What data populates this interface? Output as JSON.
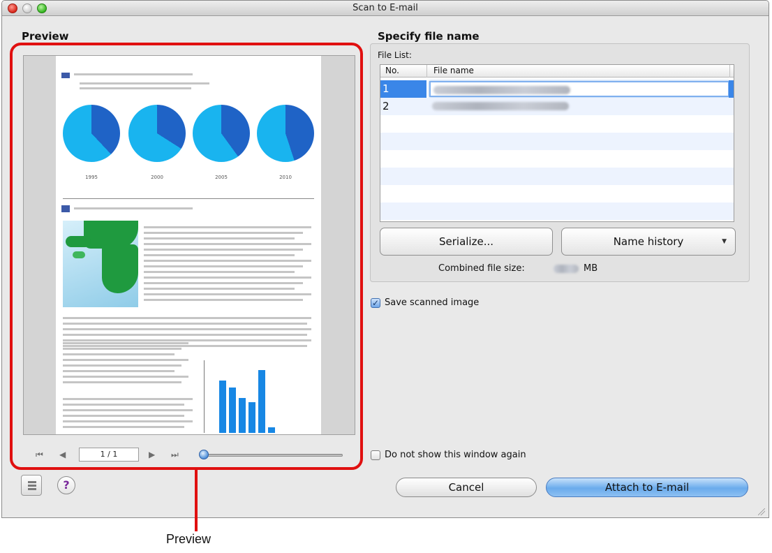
{
  "window": {
    "title": "Scan to E-mail"
  },
  "preview": {
    "section_title": "Preview",
    "page_indicator": "1 / 1",
    "document": {
      "pie_years": [
        "1995",
        "2000",
        "2005",
        "2010"
      ],
      "bar_values": [
        75,
        65,
        50,
        44,
        90,
        8
      ]
    }
  },
  "file_name": {
    "section_title": "Specify file name",
    "file_list_label": "File List:",
    "columns": [
      "No.",
      "File name"
    ],
    "rows": [
      {
        "no": "1",
        "selected": true
      },
      {
        "no": "2",
        "selected": false
      }
    ],
    "serialize_label": "Serialize...",
    "name_history_label": "Name history",
    "combined_size_label": "Combined file size:",
    "combined_size_unit": "MB"
  },
  "options": {
    "save_scanned_image": {
      "label": "Save scanned image",
      "checked": true
    },
    "do_not_show": {
      "label": "Do not show this window again",
      "checked": false
    }
  },
  "buttons": {
    "cancel": "Cancel",
    "attach": "Attach to E-mail"
  },
  "callout": {
    "label": "Preview"
  },
  "colors": {
    "highlight": "#e01010",
    "selection": "#3a86e8",
    "bar": "#1787e4",
    "pie_light": "#19b4ef",
    "pie_dark": "#1f63c6"
  }
}
